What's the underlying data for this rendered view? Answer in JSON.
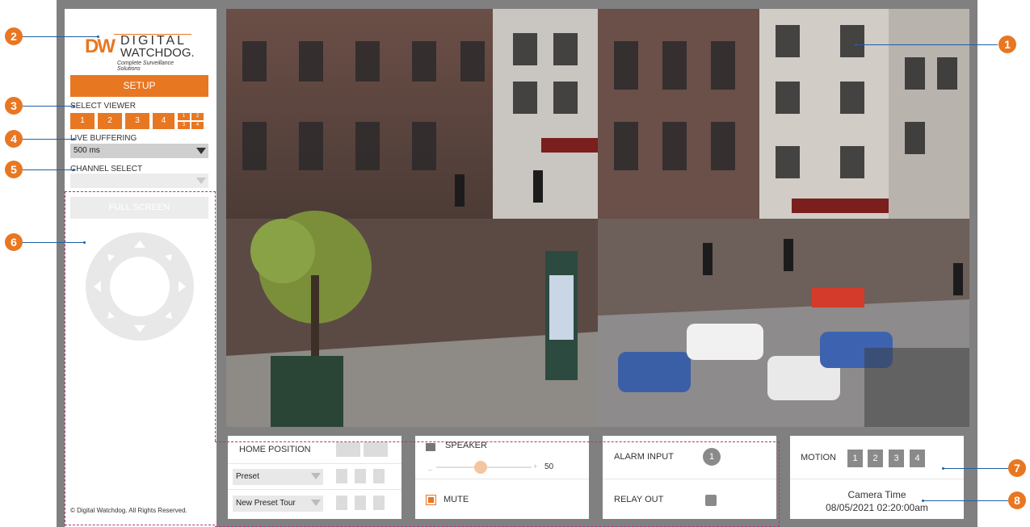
{
  "logo": {
    "mark": "DW",
    "line1": "DIGITAL",
    "line2": "WATCHDOG.",
    "tagline": "Complete Surveillance Solutions"
  },
  "sidebar": {
    "setup_label": "SETUP",
    "select_viewer_label": "SELECT VIEWER",
    "viewer_buttons": [
      "1",
      "2",
      "3",
      "4"
    ],
    "quad_labels": [
      "1",
      "2",
      "3",
      "4"
    ],
    "live_buffering_label": "LIVE BUFFERING",
    "live_buffering_value": "500 ms",
    "channel_select_label": "CHANNEL SELECT",
    "channel_select_value": "",
    "full_screen_label": "FULL SCREEN",
    "copyright": "© Digital Watchdog. All Rights Reserved."
  },
  "ptz_panel": {
    "home_position_label": "HOME POSITION",
    "preset_select": "Preset",
    "preset_tour_select": "New Preset Tour"
  },
  "audio_panel": {
    "speaker_label": "SPEAKER",
    "volume_value": "50",
    "volume_fraction": 0.47,
    "mute_label": "MUTE"
  },
  "io_panel": {
    "alarm_input_label": "ALARM INPUT",
    "alarm_input_badge": "1",
    "relay_out_label": "RELAY OUT"
  },
  "motion_panel": {
    "motion_label": "MOTION",
    "channels": [
      "1",
      "2",
      "3",
      "4"
    ],
    "camera_time_label": "Camera Time",
    "camera_time_value": "08/05/2021 02:20:00am"
  },
  "callouts": [
    "1",
    "2",
    "3",
    "4",
    "5",
    "6",
    "7",
    "8"
  ],
  "colors": {
    "accent": "#e87722",
    "frame": "#808080",
    "callout_line": "#1f5fa5",
    "dashed_border": "#b5347a"
  }
}
